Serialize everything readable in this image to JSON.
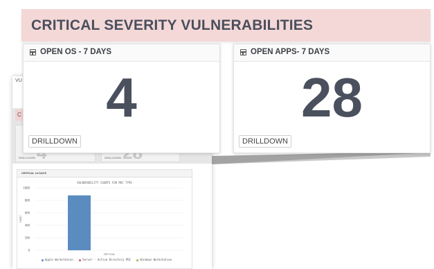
{
  "background": {
    "title": "VU",
    "pink_letter": "C",
    "card_drilldown_1": "DRILLDOWN",
    "card_drilldown_2": "DRILLDOWN",
    "card_value_1": "4",
    "card_value_2": "28",
    "chart_panel_title": "CRITICAL 14 DAYS"
  },
  "zoom": {
    "header_title": "CRITICAL SEVERITY VULNERABILITIES",
    "cards": [
      {
        "label": "OPEN OS - 7 DAYS",
        "value": "4",
        "drilldown": "DRILLDOWN"
      },
      {
        "label": "OPEN APPS- 7 DAYS",
        "value": "28",
        "drilldown": "DRILLDOWN"
      }
    ]
  },
  "chart_data": {
    "type": "bar",
    "title": "VULNERABILITY COUNTS FOR MAC TYPE",
    "ylabel": "COUNT",
    "categories": [
      "CRITICAL"
    ],
    "series": [
      {
        "name": "Apple Workstation",
        "values": [
          880
        ],
        "color": "#5b8cc0"
      },
      {
        "name": "Server - Active Directory PDC",
        "values": [
          0
        ],
        "color": "#d9534f"
      },
      {
        "name": "Windows Workstation",
        "values": [
          0
        ],
        "color": "#8fb84a"
      }
    ],
    "yticks": [
      "1000",
      "800",
      "600",
      "400",
      "200",
      "0"
    ],
    "ylim": [
      0,
      1000
    ],
    "grid": true,
    "legend": "bottom"
  }
}
